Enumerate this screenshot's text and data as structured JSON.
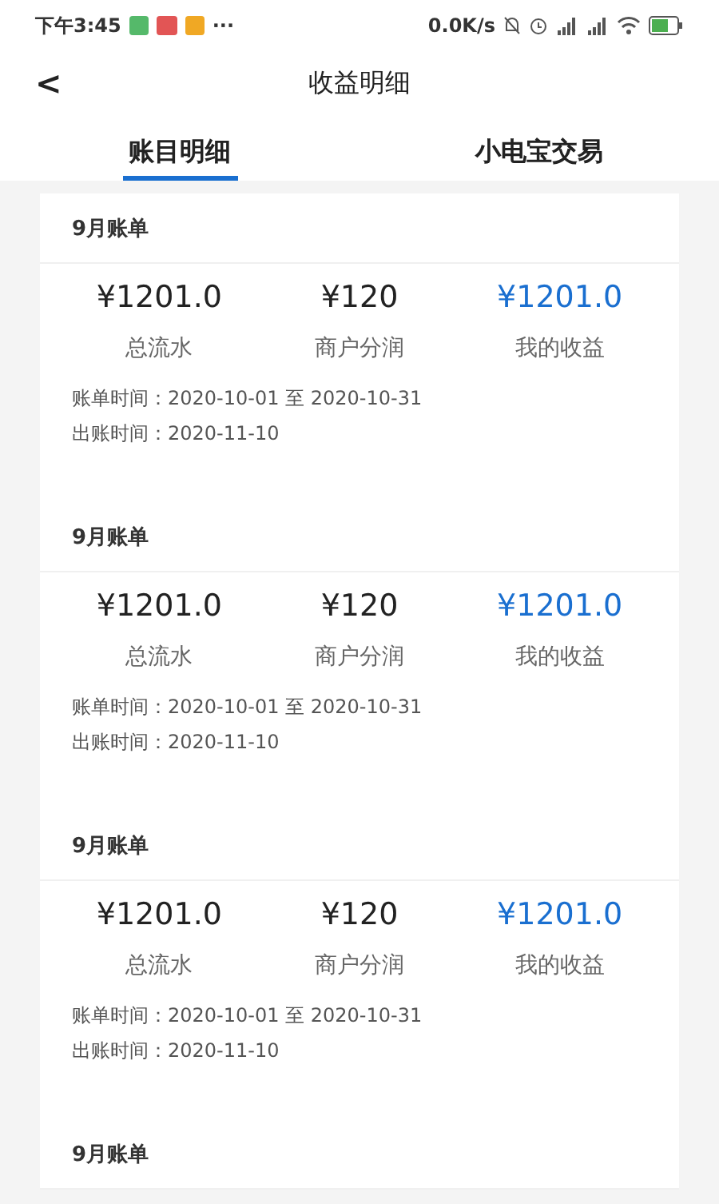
{
  "status_bar": {
    "time": "下午3:45",
    "more": "···",
    "speed": "0.0K/s"
  },
  "header": {
    "back": "<",
    "title": "收益明细"
  },
  "tabs": [
    {
      "label": "账目明细",
      "selected": true
    },
    {
      "label": "小电宝交易",
      "selected": false
    }
  ],
  "bills": [
    {
      "title": "9月账单",
      "amounts": [
        {
          "value": "¥1201.0",
          "label": "总流水",
          "highlight": false
        },
        {
          "value": "¥120",
          "label": "商户分润",
          "highlight": false
        },
        {
          "value": "¥1201.0",
          "label": "我的收益",
          "highlight": true
        }
      ],
      "period": "账单时间：2020-10-01 至 2020-10-31",
      "issued": "出账时间：2020-11-10"
    },
    {
      "title": "9月账单",
      "amounts": [
        {
          "value": "¥1201.0",
          "label": "总流水",
          "highlight": false
        },
        {
          "value": "¥120",
          "label": "商户分润",
          "highlight": false
        },
        {
          "value": "¥1201.0",
          "label": "我的收益",
          "highlight": true
        }
      ],
      "period": "账单时间：2020-10-01 至 2020-10-31",
      "issued": "出账时间：2020-11-10"
    },
    {
      "title": "9月账单",
      "amounts": [
        {
          "value": "¥1201.0",
          "label": "总流水",
          "highlight": false
        },
        {
          "value": "¥120",
          "label": "商户分润",
          "highlight": false
        },
        {
          "value": "¥1201.0",
          "label": "我的收益",
          "highlight": true
        }
      ],
      "period": "账单时间：2020-10-01 至 2020-10-31",
      "issued": "出账时间：2020-11-10"
    },
    {
      "title": "9月账单"
    }
  ]
}
